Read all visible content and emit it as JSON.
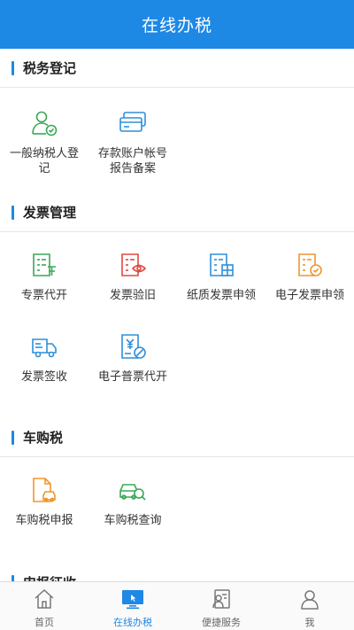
{
  "header": {
    "title": "在线办税"
  },
  "sections": [
    {
      "title": "税务登记",
      "items": [
        {
          "label": "一般纳税人登记",
          "icon": "person-check-icon"
        },
        {
          "label": "存款账户帐号报告备案",
          "icon": "bank-card-icon"
        }
      ]
    },
    {
      "title": "发票管理",
      "items": [
        {
          "label": "专票代开",
          "icon": "invoice-special-icon"
        },
        {
          "label": "发票验旧",
          "icon": "invoice-eye-icon"
        },
        {
          "label": "纸质发票申领",
          "icon": "invoice-grid-icon"
        },
        {
          "label": "电子发票申领",
          "icon": "invoice-check-icon"
        },
        {
          "label": "发票签收",
          "icon": "delivery-truck-icon"
        },
        {
          "label": "电子普票代开",
          "icon": "yuan-document-icon"
        }
      ]
    },
    {
      "title": "车购税",
      "items": [
        {
          "label": "车购税申报",
          "icon": "car-document-icon"
        },
        {
          "label": "车购税查询",
          "icon": "car-search-icon"
        }
      ]
    },
    {
      "title": "申报征收"
    }
  ],
  "tabbar": [
    {
      "label": "首页",
      "icon": "home-icon"
    },
    {
      "label": "在线办税",
      "icon": "monitor-icon"
    },
    {
      "label": "便捷服务",
      "icon": "service-card-icon"
    },
    {
      "label": "我",
      "icon": "user-icon"
    }
  ],
  "colors": {
    "brand": "#1e88e5",
    "green": "#3aa856",
    "blue": "#2f8fd8",
    "red": "#e0483e",
    "orange": "#f0962b"
  }
}
